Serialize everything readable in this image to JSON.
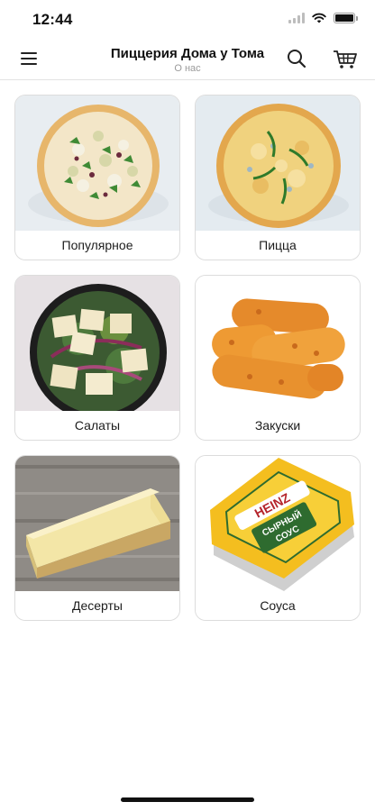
{
  "status_bar": {
    "time": "12:44"
  },
  "header": {
    "title": "Пиццерия Дома у Тома",
    "subtitle": "О нас",
    "menu_icon": "hamburger-icon",
    "search_icon": "search-icon",
    "cart_icon": "cart-icon"
  },
  "categories": [
    {
      "label": "Популярное",
      "icon": "pizza-image"
    },
    {
      "label": "Пицца",
      "icon": "pizza-image"
    },
    {
      "label": "Салаты",
      "icon": "salad-bowl-image"
    },
    {
      "label": "Закуски",
      "icon": "fried-sticks-image"
    },
    {
      "label": "Десерты",
      "icon": "cheesecake-image"
    },
    {
      "label": "Соуса",
      "icon": "sauce-cup-image"
    }
  ],
  "sauce_cup": {
    "brand": "HEINZ",
    "line1": "СЫРНЫЙ",
    "line2": "СОУС"
  }
}
